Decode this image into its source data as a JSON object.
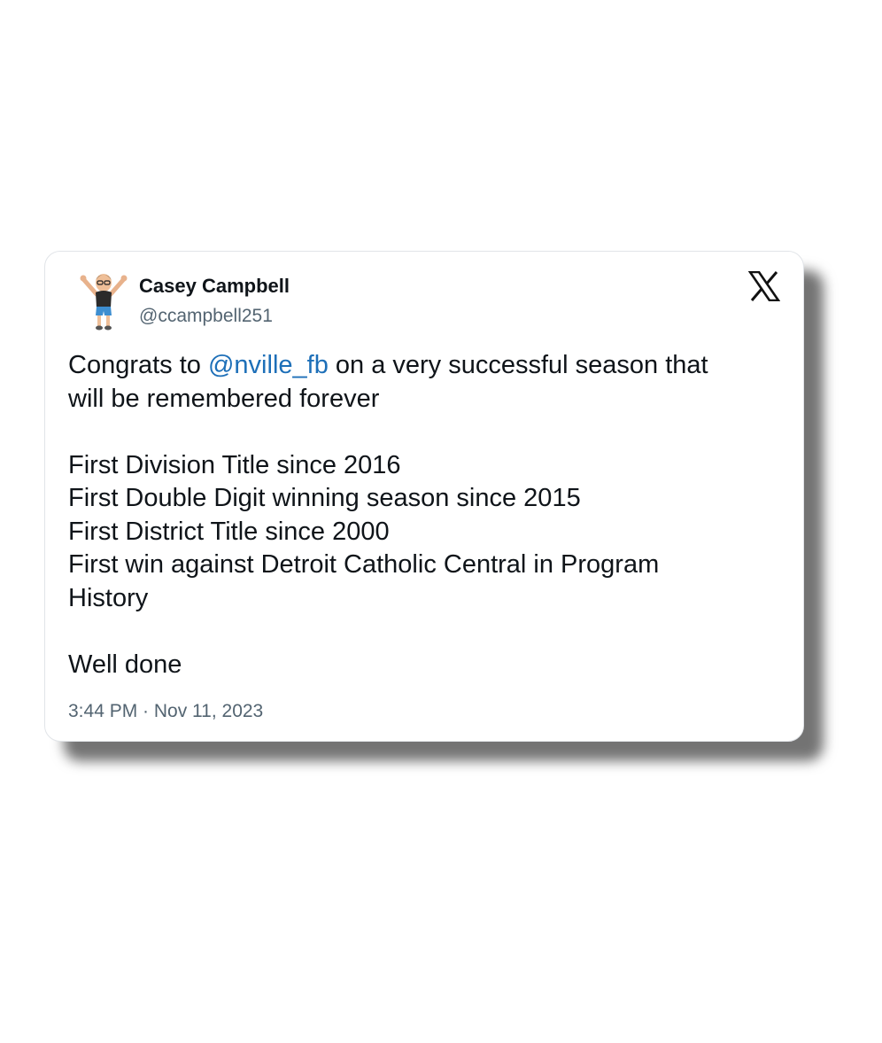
{
  "tweet": {
    "author_name": "Casey Campbell",
    "author_handle": "@ccampbell251",
    "avatar_icon": "memoji-avatar-icon",
    "platform_icon": "x-logo-icon",
    "lines": {
      "l1_pre": "Congrats to ",
      "l1_mention": "@nville_fb",
      "l1_post": " on a very successful season that",
      "l2": "will be remembered forever",
      "l3": "First Division Title since 2016",
      "l4": "First Double Digit winning season since 2015",
      "l5": "First District Title since 2000",
      "l6": "First win against Detroit Catholic Central in Program",
      "l7": "History",
      "l8": "Well done"
    },
    "timestamp": "3:44 PM · Nov 11, 2023"
  },
  "colors": {
    "mention": "#1d6fb8",
    "text": "#0f1419",
    "secondary": "#536471"
  }
}
